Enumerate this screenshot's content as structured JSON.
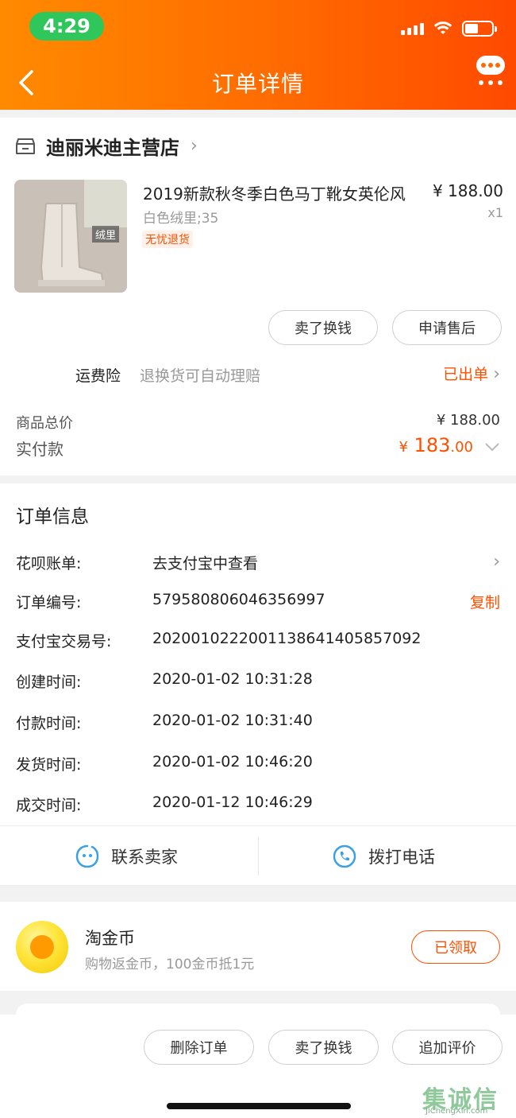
{
  "status_bar": {
    "time": "4:29"
  },
  "header": {
    "title": "订单详情"
  },
  "shop": {
    "name": "迪丽米迪主营店"
  },
  "product": {
    "title": "2019新款秋冬季白色马丁靴女英伦风",
    "price": "¥ 188.00",
    "sku": "白色绒里;35",
    "qty": "x1",
    "badge": "无忧退货",
    "image_tag": "绒里"
  },
  "item_actions": {
    "sell": "卖了换钱",
    "after_sale": "申请售后"
  },
  "insurance": {
    "label": "运费险",
    "desc": "退换货可自动理赔",
    "status": "已出单"
  },
  "summary": {
    "total_label": "商品总价",
    "total_value": "¥ 188.00",
    "paid_label": "实付款",
    "paid_symbol": "¥",
    "paid_int": "183",
    "paid_dec": ".00"
  },
  "order_info": {
    "title": "订单信息",
    "rows": [
      {
        "key": "花呗账单:",
        "value": "去支付宝中查看"
      },
      {
        "key": "订单编号:",
        "value": "579580806046356997",
        "action": "复制"
      },
      {
        "key": "支付宝交易号:",
        "value": "2020010222001138641405857092"
      },
      {
        "key": "创建时间:",
        "value": "2020-01-02 10:31:28"
      },
      {
        "key": "付款时间:",
        "value": "2020-01-02 10:31:40"
      },
      {
        "key": "发货时间:",
        "value": "2020-01-02 10:46:20"
      },
      {
        "key": "成交时间:",
        "value": "2020-01-12 10:46:29"
      }
    ]
  },
  "contact": {
    "seller": "联系卖家",
    "phone": "拨打电话"
  },
  "coins": {
    "title": "淘金币",
    "desc": "购物返金币，100金币抵1元",
    "button": "已领取"
  },
  "bottom_actions": {
    "delete": "删除订单",
    "sell": "卖了换钱",
    "review": "追加评价"
  },
  "watermark": {
    "text": "集诚信",
    "sub": "JiChengXin.com"
  },
  "colors": {
    "accent": "#ff5000",
    "header_start": "#ff8a00",
    "header_end": "#ff4a00",
    "time_pill": "#2fc75c"
  }
}
